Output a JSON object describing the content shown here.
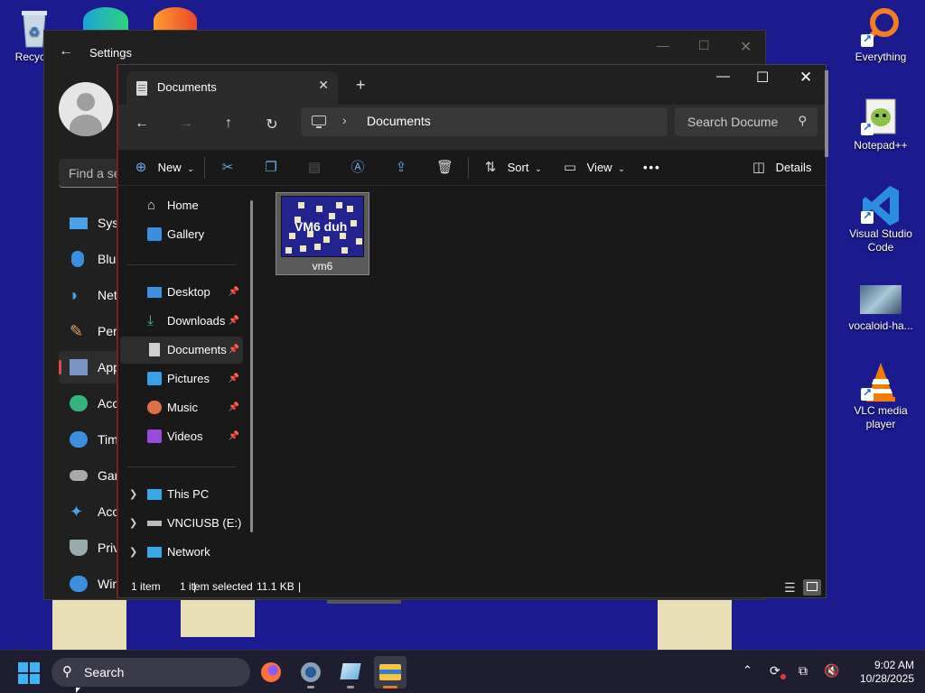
{
  "desktop": {
    "icons": [
      {
        "label": "Recycle",
        "icon": "recycle-bin-icon"
      },
      {
        "label": "Everything",
        "icon": "everything-search-icon"
      },
      {
        "label": "Notepad++",
        "icon": "notepadplusplus-icon"
      },
      {
        "label": "Visual Studio Code",
        "icon": "vscode-icon"
      },
      {
        "label": "vocaloid-ha...",
        "icon": "image-file-icon"
      },
      {
        "label": "VLC media player",
        "icon": "vlc-icon"
      }
    ]
  },
  "settings": {
    "title": "Settings",
    "find_placeholder": "Find a se",
    "nav": [
      {
        "label": "Sys",
        "icon": "system-icon"
      },
      {
        "label": "Blu",
        "icon": "bluetooth-icon"
      },
      {
        "label": "Net",
        "icon": "network-wifi-icon"
      },
      {
        "label": "Per",
        "icon": "personalization-brush-icon"
      },
      {
        "label": "App",
        "icon": "apps-icon"
      },
      {
        "label": "Acc",
        "icon": "accounts-icon"
      },
      {
        "label": "Tim",
        "icon": "time-language-icon"
      },
      {
        "label": "Gar",
        "icon": "gaming-icon"
      },
      {
        "label": "Acc",
        "icon": "accessibility-icon"
      },
      {
        "label": "Priv",
        "icon": "privacy-shield-icon"
      },
      {
        "label": "Win",
        "icon": "windows-update-icon"
      }
    ]
  },
  "explorer": {
    "tab_title": "Documents",
    "address": {
      "path": "Documents"
    },
    "search_placeholder": "Search Documents",
    "toolbar": {
      "new": "New",
      "sort": "Sort",
      "view": "View",
      "more": "•••",
      "details": "Details"
    },
    "nav": {
      "home": "Home",
      "gallery": "Gallery",
      "desktop": "Desktop",
      "downloads": "Downloads",
      "documents": "Documents",
      "pictures": "Pictures",
      "music": "Music",
      "videos": "Videos",
      "this_pc": "This PC",
      "usb": "VNCIUSB (E:)",
      "network": "Network"
    },
    "files": [
      {
        "name": "vm6",
        "thumb_text": "VM6 duh"
      }
    ],
    "status": {
      "items": "1 item",
      "selected": "1 item selected",
      "size": "11.1 KB"
    }
  },
  "taskbar": {
    "search_label": "Search",
    "time": "9:02 AM",
    "date": "10/28/2025"
  },
  "colors": {
    "desktop_bg": "#1b1a8e",
    "accent": "#6ea7e6",
    "taskbar_active": "#e07a3a"
  }
}
